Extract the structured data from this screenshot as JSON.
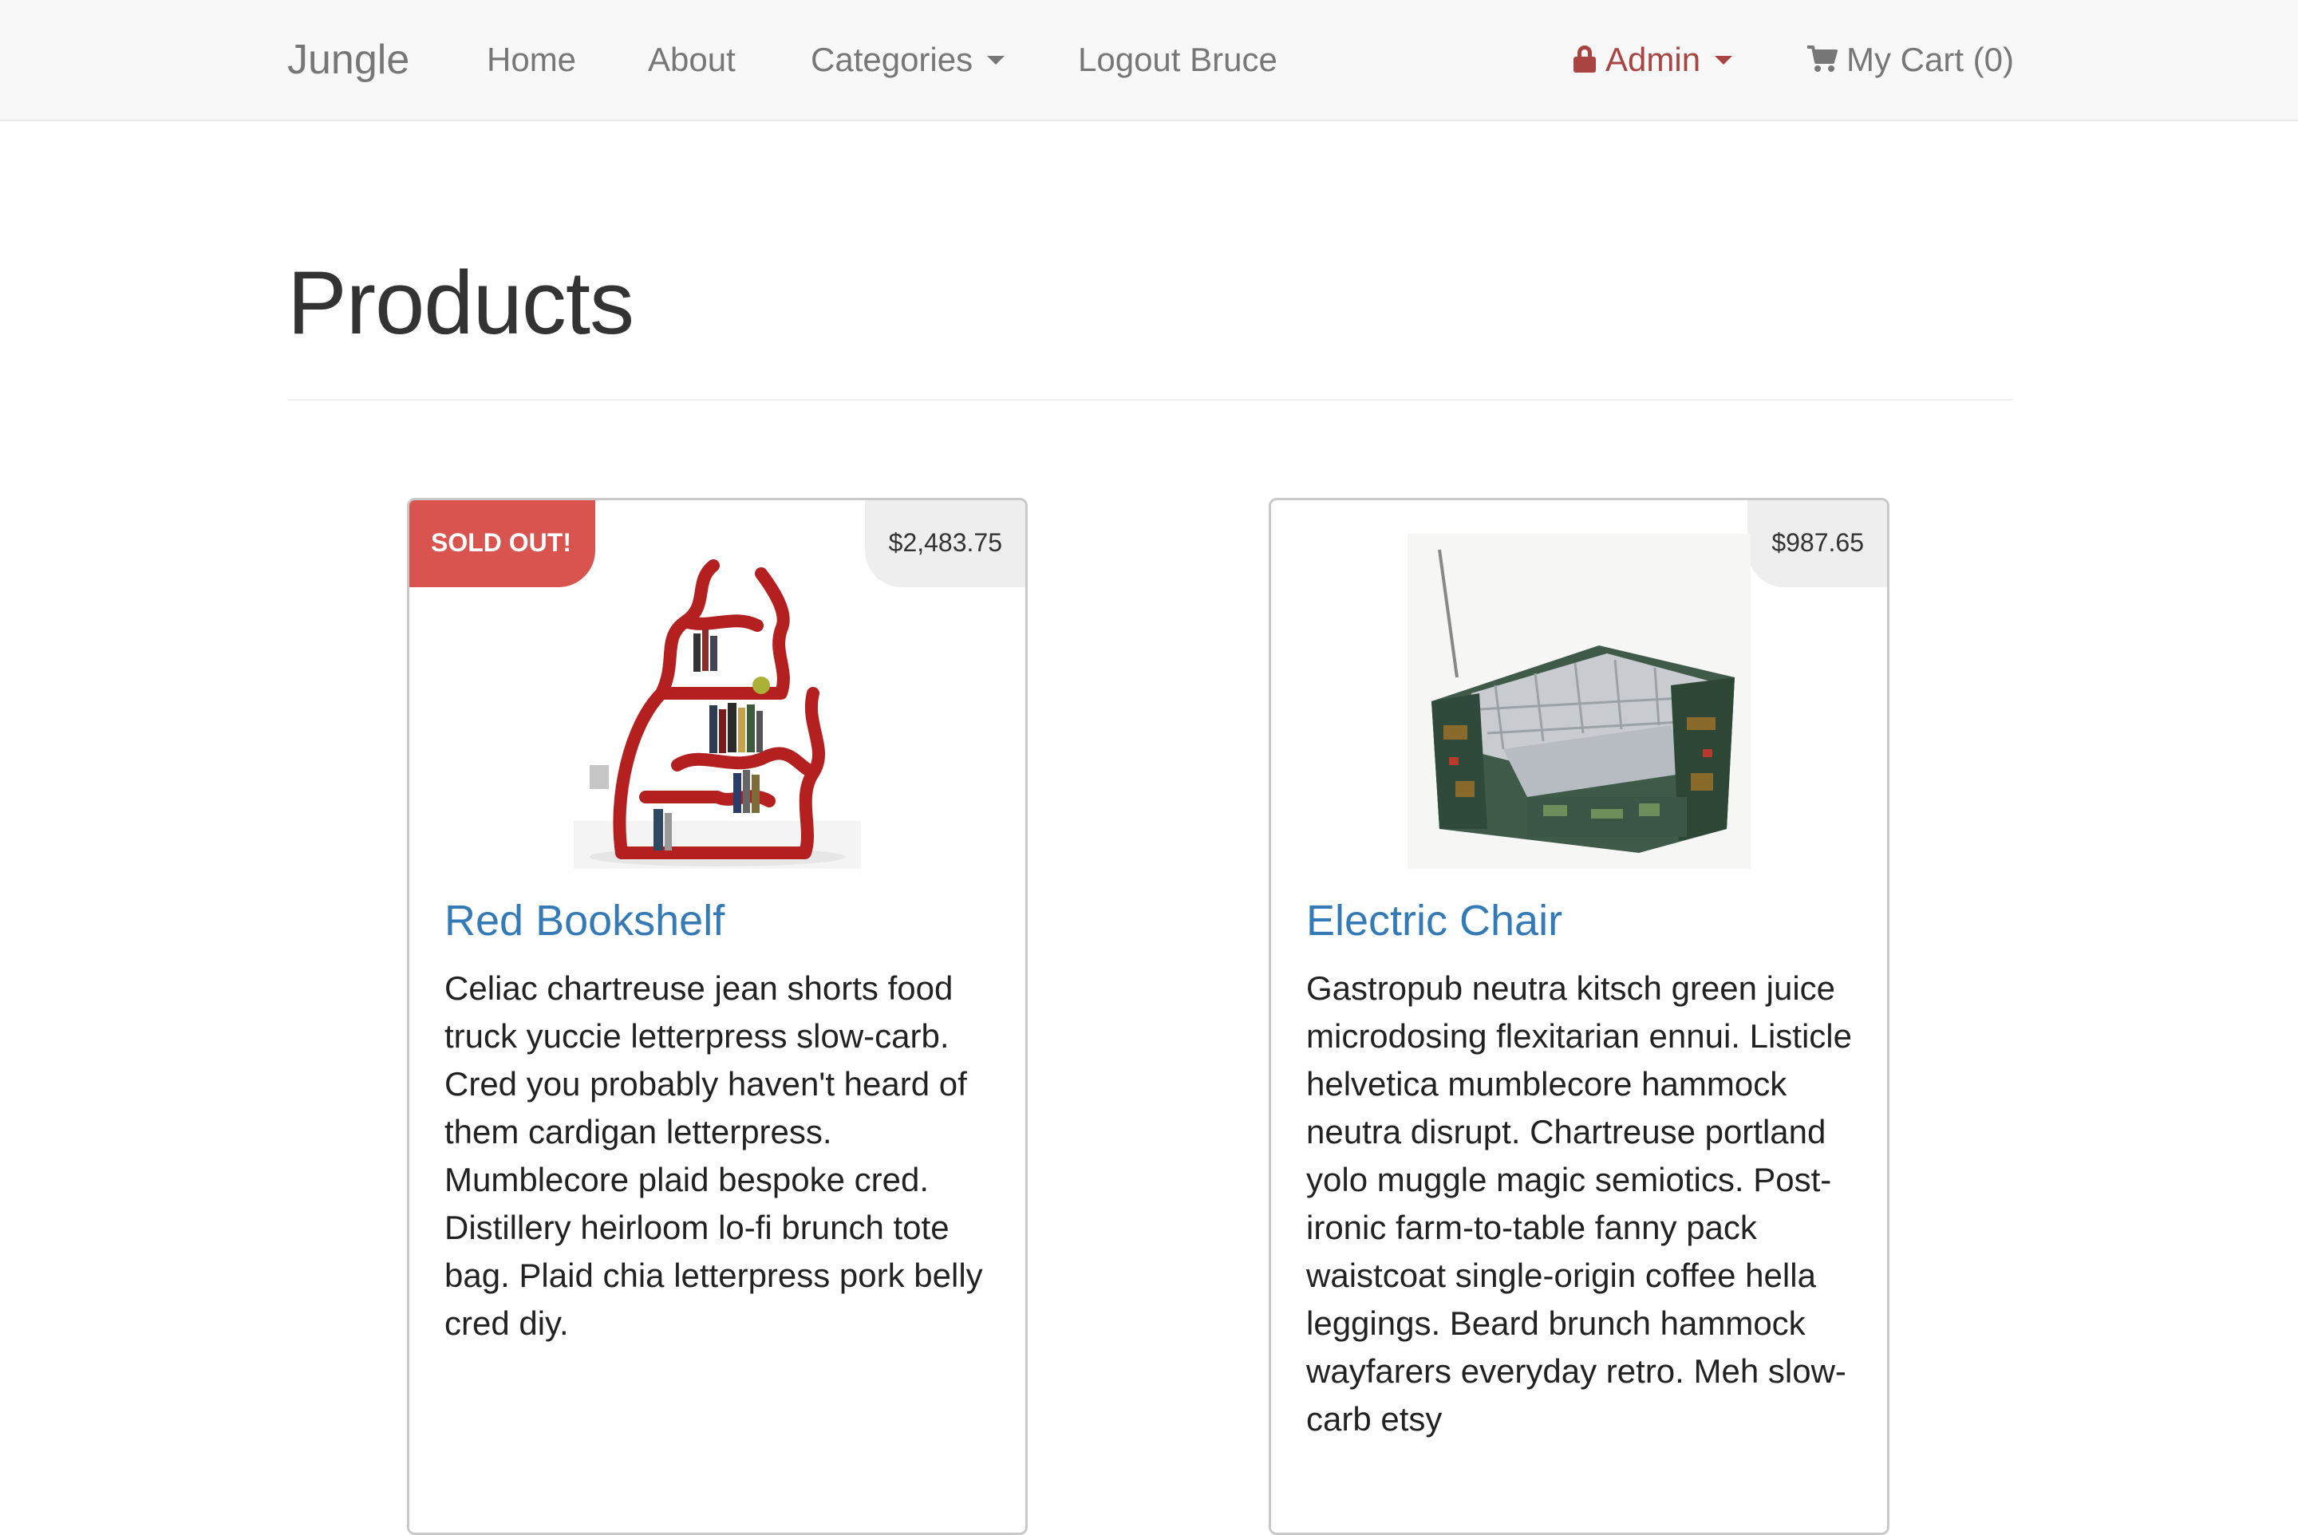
{
  "navbar": {
    "brand": "Jungle",
    "links": [
      "Home",
      "About",
      "Categories",
      "Logout Bruce"
    ],
    "admin_label": "Admin",
    "cart_label": "My Cart (0)"
  },
  "page": {
    "title": "Products"
  },
  "products": [
    {
      "name": "Red Bookshelf",
      "price": "$2,483.75",
      "badge": "SOLD OUT!",
      "description": "Celiac chartreuse jean shorts food truck yuccie letterpress slow-carb. Cred you probably haven't heard of them cardigan letterpress. Mumblecore plaid bespoke cred. Distillery heirloom lo-fi brunch tote bag. Plaid chia letterpress pork belly cred diy.",
      "image_icon": "red-bookshelf-image"
    },
    {
      "name": "Electric Chair",
      "price": "$987.65",
      "description": "Gastropub neutra kitsch green juice microdosing flexitarian ennui. Listicle helvetica mumblecore hammock neutra disrupt. Chartreuse portland yolo muggle magic semiotics. Post-ironic farm-to-table fanny pack waistcoat single-origin coffee hella leggings. Beard brunch hammock wayfarers everyday retro. Meh slow-carb etsy",
      "image_icon": "electric-chair-image"
    }
  ],
  "colors": {
    "navbar_bg": "#f8f8f8",
    "link": "#337ab7",
    "admin": "#a94442",
    "soldout": "#d9534f"
  }
}
